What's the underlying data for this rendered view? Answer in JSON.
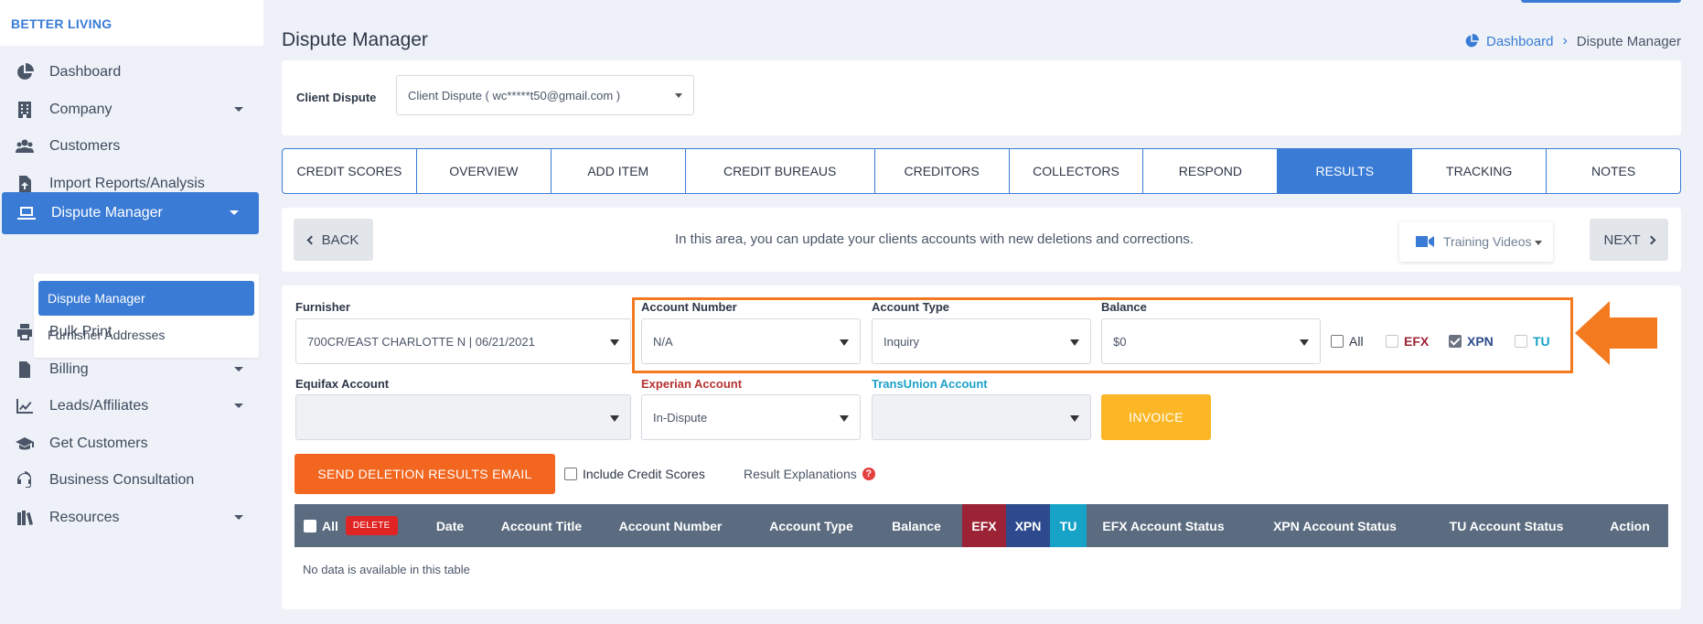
{
  "brand": "BETTER LIVING",
  "sidebar": {
    "items": [
      {
        "label": "Dashboard",
        "icon": "pie-chart-icon"
      },
      {
        "label": "Company",
        "icon": "building-icon"
      },
      {
        "label": "Customers",
        "icon": "users-icon"
      },
      {
        "label": "Import Reports/Analysis",
        "icon": "file-upload-icon"
      },
      {
        "label": "Dispute Manager",
        "icon": "laptop-icon"
      },
      {
        "label": "Bulk Print",
        "icon": "printer-icon"
      },
      {
        "label": "Billing",
        "icon": "invoice-icon"
      },
      {
        "label": "Leads/Affiliates",
        "icon": "line-chart-icon"
      },
      {
        "label": "Get Customers",
        "icon": "graduation-cap-icon"
      },
      {
        "label": "Business Consultation",
        "icon": "headset-icon"
      },
      {
        "label": "Resources",
        "icon": "books-icon"
      }
    ],
    "submenu": [
      "Dispute Manager",
      "Furnisher Addresses"
    ]
  },
  "header": {
    "title": "Dispute Manager",
    "breadcrumb": {
      "home": "Dashboard",
      "current": "Dispute Manager"
    }
  },
  "client": {
    "label": "Client Dispute",
    "value": "Client Dispute ( wc*****t50@gmail.com )"
  },
  "tabs": [
    {
      "label": "CREDIT SCORES"
    },
    {
      "label": "OVERVIEW"
    },
    {
      "label": "ADD ITEM"
    },
    {
      "label": "CREDIT BUREAUS"
    },
    {
      "label": "CREDITORS"
    },
    {
      "label": "COLLECTORS"
    },
    {
      "label": "RESPOND"
    },
    {
      "label": "RESULTS",
      "active": true
    },
    {
      "label": "TRACKING"
    },
    {
      "label": "NOTES"
    }
  ],
  "actions": {
    "back": "BACK",
    "next": "NEXT",
    "info": "In this area, you can update your clients accounts with new deletions and corrections.",
    "training": "Training Videos"
  },
  "form": {
    "furnisher": {
      "label": "Furnisher",
      "value": "700CR/EAST CHARLOTTE N | 06/21/2021"
    },
    "account_number": {
      "label": "Account Number",
      "value": "N/A"
    },
    "account_type": {
      "label": "Account Type",
      "value": "Inquiry"
    },
    "balance": {
      "label": "Balance",
      "value": "$0"
    },
    "bureaus": {
      "all": "All",
      "efx": "EFX",
      "xpn": "XPN",
      "tu": "TU",
      "xpn_checked": true
    },
    "equifax_account": {
      "label": "Equifax Account",
      "value": ""
    },
    "experian_account": {
      "label": "Experian Account",
      "value": "In-Dispute"
    },
    "transunion_account": {
      "label": "TransUnion Account",
      "value": ""
    },
    "invoice": "INVOICE",
    "send_email": "SEND DELETION RESULTS EMAIL",
    "include_scores": "Include Credit Scores",
    "result_explanations": "Result Explanations"
  },
  "table": {
    "all": "All",
    "delete": "DELETE",
    "columns": [
      "Date",
      "Account Title",
      "Account Number",
      "Account Type",
      "Balance",
      "EFX",
      "XPN",
      "TU",
      "EFX Account Status",
      "XPN Account Status",
      "TU Account Status",
      "Action"
    ],
    "empty": "No data is available in this table"
  },
  "colors": {
    "primary": "#3a7bd5",
    "highlight": "#f47a20",
    "invoice": "#fbb726",
    "email_button": "#f2661f",
    "efx": "#9b2335",
    "xpn": "#2e4a8e",
    "tu": "#17a2c7"
  }
}
